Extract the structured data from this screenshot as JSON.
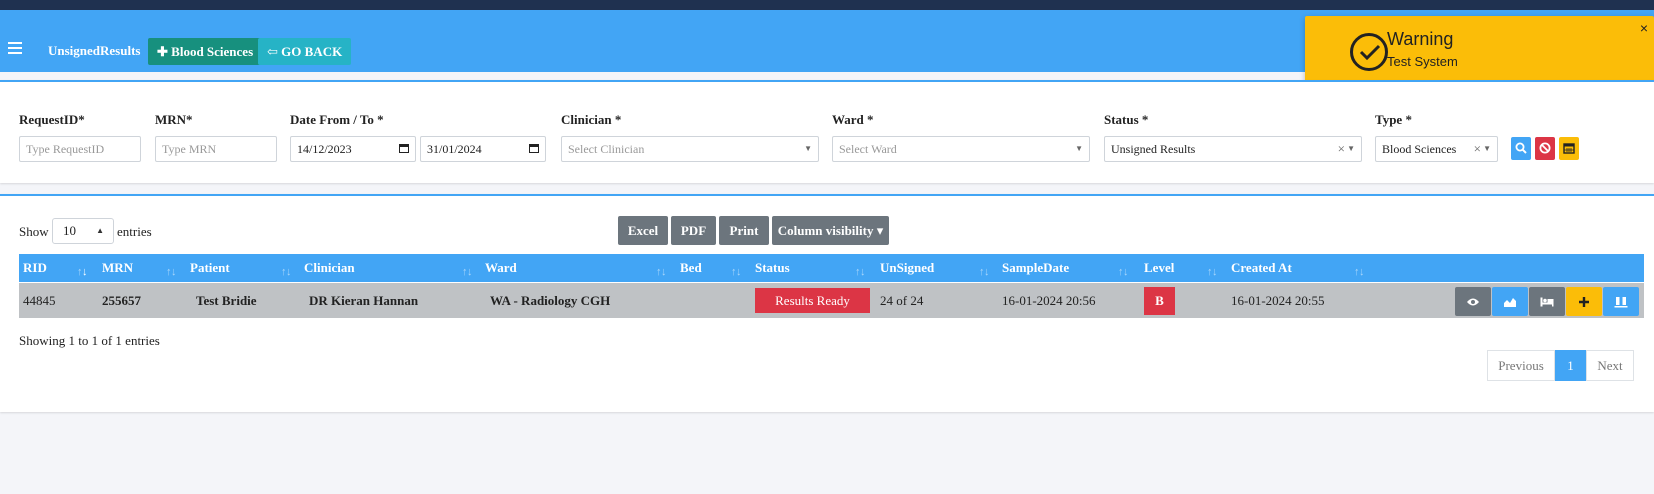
{
  "header": {
    "app_title": "UnsignedResults",
    "blood_sciences_button": "Blood Sciences",
    "go_back_button": "GO BACK"
  },
  "toast": {
    "title": "Warning",
    "message": "Test System",
    "close": "×"
  },
  "filters": {
    "request_id": {
      "label": "RequestID*",
      "placeholder": "Type RequestID"
    },
    "mrn": {
      "label": "MRN*",
      "placeholder": "Type MRN"
    },
    "date_range": {
      "label": "Date From / To *",
      "from": "14/12/2023",
      "to": "31/01/2024"
    },
    "clinician": {
      "label": "Clinician *",
      "placeholder": "Select Clinician"
    },
    "ward": {
      "label": "Ward *",
      "placeholder": "Select Ward"
    },
    "status": {
      "label": "Status *",
      "value": "Unsigned Results"
    },
    "type": {
      "label": "Type *",
      "value": "Blood Sciences"
    }
  },
  "table_controls": {
    "show_prefix": "Show",
    "entries_value": "10",
    "show_suffix": "entries",
    "buttons": [
      "Excel",
      "PDF",
      "Print",
      "Column visibility ▾"
    ]
  },
  "table": {
    "columns": [
      "RID",
      "MRN",
      "Patient",
      "Clinician",
      "Ward",
      "Bed",
      "Status",
      "UnSigned",
      "SampleDate",
      "Level",
      "Created At"
    ],
    "rows": [
      {
        "rid": "44845",
        "mrn": "255657",
        "patient": "Test Bridie",
        "clinician": "DR Kieran Hannan",
        "ward": "WA - Radiology CGH",
        "bed": "",
        "status": "Results Ready",
        "unsigned": "24 of 24",
        "sample_date": "16-01-2024 20:56",
        "level": "B",
        "created_at": "16-01-2024 20:55"
      }
    ]
  },
  "footer": {
    "info": "Showing 1 to 1 of 1 entries",
    "previous": "Previous",
    "page": "1",
    "next": "Next"
  },
  "colors": {
    "header": "#42a5f5",
    "blood_sciences_btn": "#17907e",
    "go_back_btn": "#26b3c6",
    "toast": "#fbbd08",
    "danger": "#dc3545",
    "secondary": "#6c757d"
  }
}
